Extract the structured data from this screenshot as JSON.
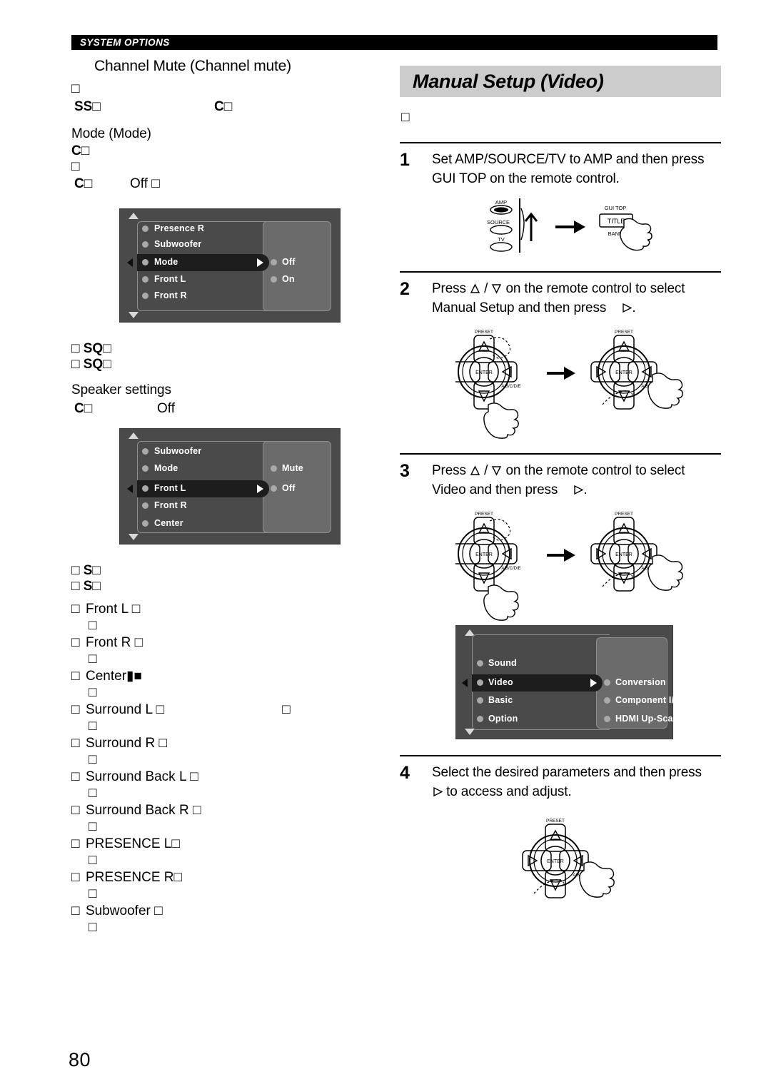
{
  "page": {
    "running_head": "SYSTEM OPTIONS",
    "page_number": "80"
  },
  "left_column": {
    "heading": "Channel Mute (Channel mute)",
    "lines": [
      {
        "id": "l1",
        "text": "□",
        "bold": false
      },
      {
        "id": "l2",
        "text": "SS□",
        "second": "C□",
        "bold": true
      }
    ],
    "mode_heading": "Mode (Mode)",
    "mode_lines": [
      "C□",
      "□"
    ],
    "control_line_label": "C□",
    "control_line_value": "Off □",
    "osd_mode": {
      "left_items": [
        "Presence R",
        "Subwoofer",
        "Mode",
        "Front L",
        "Front R"
      ],
      "selected": "Mode",
      "right_items": [
        "Off",
        "On"
      ]
    },
    "notes_after_mode": [
      "□ SQ□",
      "□ SQ□"
    ],
    "speaker_heading": "Speaker settings",
    "speaker_line_label": "C□",
    "speaker_line_value": "Off",
    "osd_channel": {
      "left_items": [
        "Subwoofer",
        "Mode",
        "Front L",
        "Front R",
        "Center"
      ],
      "selected": "Front L",
      "right_items": [
        "Mute",
        "Off"
      ]
    },
    "notes_after_channel": [
      "□ S□",
      "□ S□"
    ],
    "channel_list": [
      {
        "label": "Front L",
        "trailing": "□",
        "sub": "□",
        "extra": ""
      },
      {
        "label": "Front R",
        "trailing": "□",
        "sub": "□",
        "extra": ""
      },
      {
        "label": "Center",
        "trailing": "▮■",
        "sub": "□",
        "extra": ""
      },
      {
        "label": "Surround L",
        "trailing": "□",
        "sub": "□",
        "extra": "□"
      },
      {
        "label": "Surround R",
        "trailing": "□",
        "sub": "□",
        "extra": ""
      },
      {
        "label": "Surround Back L",
        "trailing": "□",
        "sub": "□",
        "extra": ""
      },
      {
        "label": "Surround Back R",
        "trailing": "□",
        "sub": "□",
        "extra": ""
      },
      {
        "label": "PRESENCE L",
        "trailing": "□",
        "sub": "□",
        "extra": ""
      },
      {
        "label": "PRESENCE R",
        "trailing": "□",
        "sub": "□",
        "extra": ""
      },
      {
        "label": "Subwoofer",
        "trailing": "□",
        "sub": "□",
        "extra": ""
      }
    ]
  },
  "right_column": {
    "title": "Manual Setup (Video)",
    "intro_glyph": "□",
    "steps": [
      {
        "num": "1",
        "line1": "Set AMP/SOURCE/TV to AMP and then press",
        "line2": "GUI TOP on the remote control.",
        "figure": "amp-source-tv-switch"
      },
      {
        "num": "2",
        "line1_a": "Press ",
        "line1_b": " / ",
        "line1_c": " on the remote control to select",
        "line2_a": "Manual Setup and then press ",
        "line2_b": ".",
        "figure": "cursor-pad-down-then-right"
      },
      {
        "num": "3",
        "line1_a": "Press ",
        "line1_b": " / ",
        "line1_c": " on the remote control to select",
        "line2_a": "Video and then press ",
        "line2_b": ".",
        "figure": "cursor-pad-down-then-right"
      },
      {
        "num": "4",
        "line1": "Select the desired parameters and then press",
        "line2_a": " to access and adjust.",
        "figure": "cursor-pad-right"
      }
    ],
    "remote_switch": {
      "positions": [
        "AMP",
        "SOURCE",
        "TV"
      ],
      "selected": "AMP",
      "button_top_label": "GUI TOP",
      "button_label": "TITLE",
      "button_bottom_label": "BAND"
    },
    "cursor_pad": {
      "preset_label": "PRESET",
      "enter_label": "ENTER",
      "abcde_label": "A/B/C/D/E"
    },
    "osd_video": {
      "left_items": [
        "Sound",
        "Video",
        "Basic",
        "Option"
      ],
      "selected": "Video",
      "right_items": [
        "Conversion",
        "Component I/P",
        "HDMI Up-Scaling"
      ]
    }
  },
  "colors": {
    "runhead_bg": "#000000",
    "title_bg": "#cccccc",
    "osd_bg": "#4a4a4a",
    "osd_panel": "#6b6b6b",
    "osd_selected": "#1d1d1d",
    "osd_dot": "#a9a9a9"
  }
}
